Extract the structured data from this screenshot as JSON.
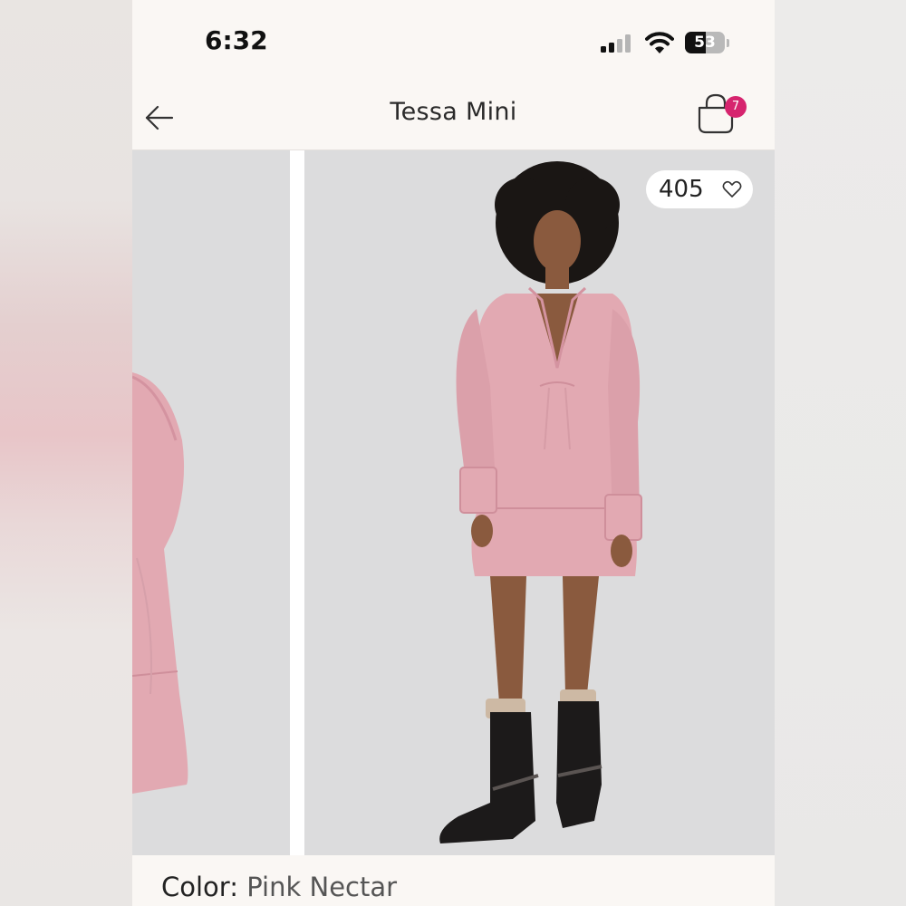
{
  "status_bar": {
    "time": "6:32",
    "battery_percent": "53",
    "battery_level": 0.53
  },
  "nav": {
    "title": "Tessa Mini",
    "cart_count": "7",
    "back_icon": "arrow-left-icon",
    "cart_icon": "shopping-bag-icon"
  },
  "product": {
    "likes": "405",
    "like_icon": "heart-outline-icon",
    "color_label": "Color:",
    "color_value": "Pink Nectar",
    "dress_color": "#e2a9b2",
    "boot_color": "#1c1a1a"
  },
  "colors": {
    "badge": "#d6246e",
    "background": "#faf7f4",
    "photo_backdrop": "#dcdcdd"
  }
}
